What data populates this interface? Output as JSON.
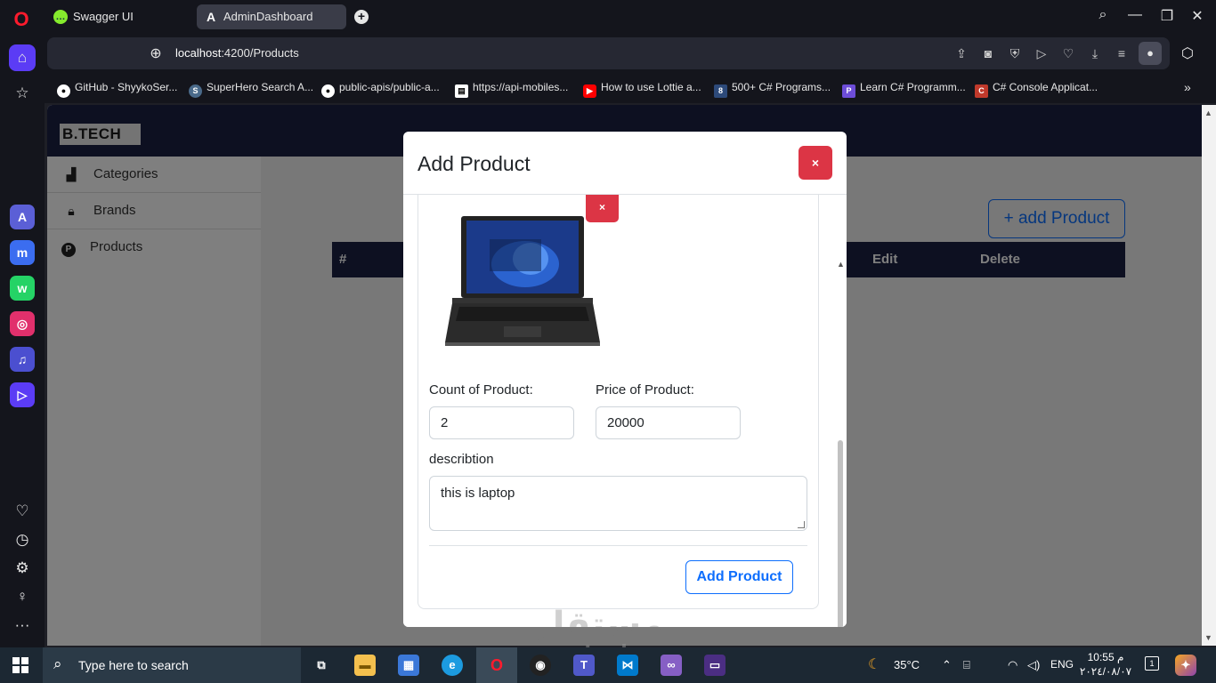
{
  "browser": {
    "tabs": [
      {
        "label": "Swagger UI",
        "icon": "swagger-icon"
      },
      {
        "label": "AdminDashboard",
        "icon": "angular-icon"
      }
    ],
    "url_host": "localhost",
    "url_path": ":4200/Products",
    "bookmarks": [
      {
        "label": "GitHub - ShyykoSer...",
        "icon": "github-icon"
      },
      {
        "label": "SuperHero Search A...",
        "icon": "superhero-icon"
      },
      {
        "label": "public-apis/public-a...",
        "icon": "github-icon"
      },
      {
        "label": "https://api-mobiles...",
        "icon": "document-icon"
      },
      {
        "label": "How to use Lottie a...",
        "icon": "youtube-icon"
      },
      {
        "label": "500+ C# Programs...",
        "icon": "site-icon"
      },
      {
        "label": "Learn C# Programm...",
        "icon": "site-icon"
      },
      {
        "label": "C# Console Applicat...",
        "icon": "site-icon"
      }
    ]
  },
  "app": {
    "brand": "B.TECH",
    "sidebar": [
      {
        "label": "Categories",
        "icon": "chart-icon"
      },
      {
        "label": "Brands",
        "icon": "lock-icon"
      },
      {
        "label": "Products",
        "icon": "p-circle-icon"
      }
    ],
    "add_button": "+ add Product",
    "table_headers": [
      "#",
      "Edit",
      "Delete"
    ]
  },
  "modal": {
    "title": "Add Product",
    "close_label": "×",
    "image_remove_label": "×",
    "count_label": "Count of Product:",
    "count_value": "2",
    "price_label": "Price of Product:",
    "price_value": "20000",
    "description_label": "describtion",
    "description_value": "this is laptop",
    "submit_label": "Add Product"
  },
  "taskbar": {
    "search_placeholder": "Type here to search",
    "temperature": "35°C",
    "language": "ENG",
    "time": "10:55 م",
    "date": "٢٠٢٤/٠٨/٠٧",
    "notifications": "1"
  },
  "colors": {
    "navy": "#1a2043",
    "danger": "#dc3545",
    "primary": "#0d6efd",
    "opera_accent": "#5b3cf5"
  },
  "watermark": {
    "arabic": "مستقل",
    "latin": "mostaql.com"
  }
}
